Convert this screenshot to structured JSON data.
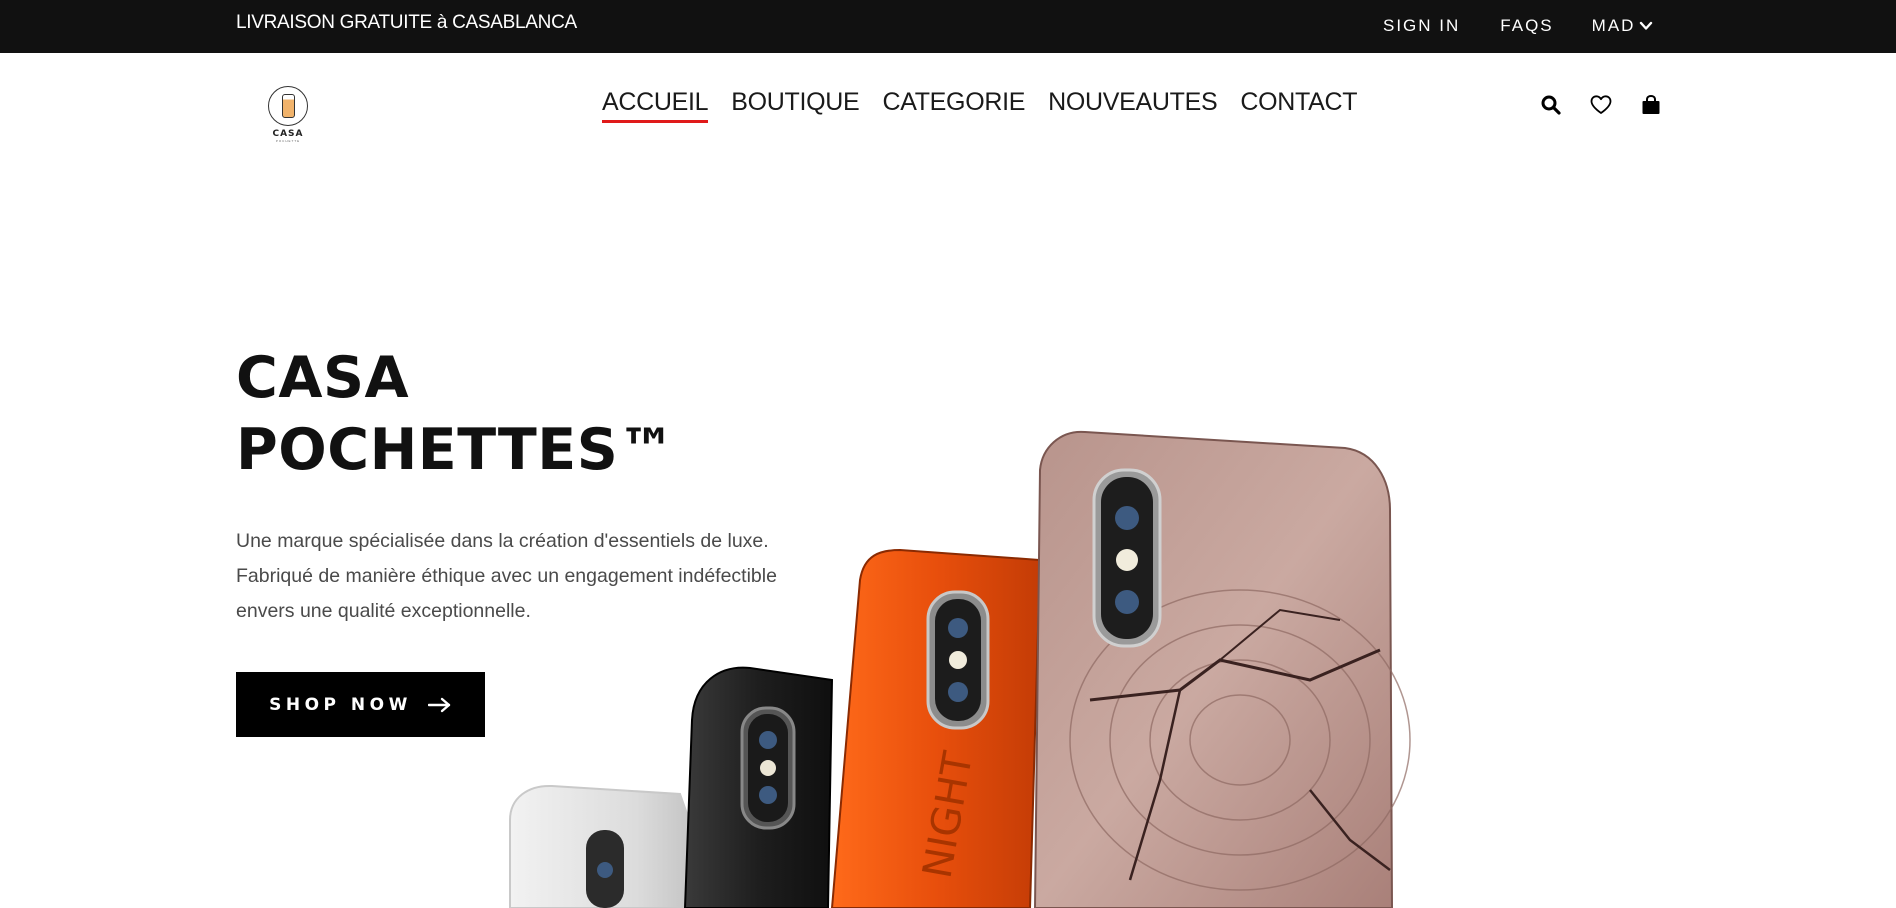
{
  "topbar": {
    "promo": "LIVRAISON GRATUITE à CASABLANCA",
    "sign_in": "SIGN IN",
    "faqs": "FAQS",
    "currency": "MAD"
  },
  "logo": {
    "text": "CASA",
    "subtext": "POCHETTE"
  },
  "nav": {
    "items": [
      "ACCUEIL",
      "BOUTIQUE",
      "CATEGORIE",
      "NOUVEAUTES",
      "CONTACT"
    ],
    "active": "ACCUEIL"
  },
  "icons": [
    "search-icon",
    "heart-icon",
    "shopping-bag-icon"
  ],
  "hero": {
    "title_line1": "CASA",
    "title_line2": "POCHETTES™",
    "desc_line1": "Une marque spécialisée dans la création d'essentiels de luxe.",
    "desc_line2": "Fabriqué de manière éthique avec un engagement indéfectible",
    "desc_line3": "envers une qualité exceptionnelle.",
    "cta": "SHOP NOW"
  },
  "colors": {
    "topbar_bg": "#111111",
    "accent": "#e01a1a",
    "button_bg": "#000000"
  }
}
